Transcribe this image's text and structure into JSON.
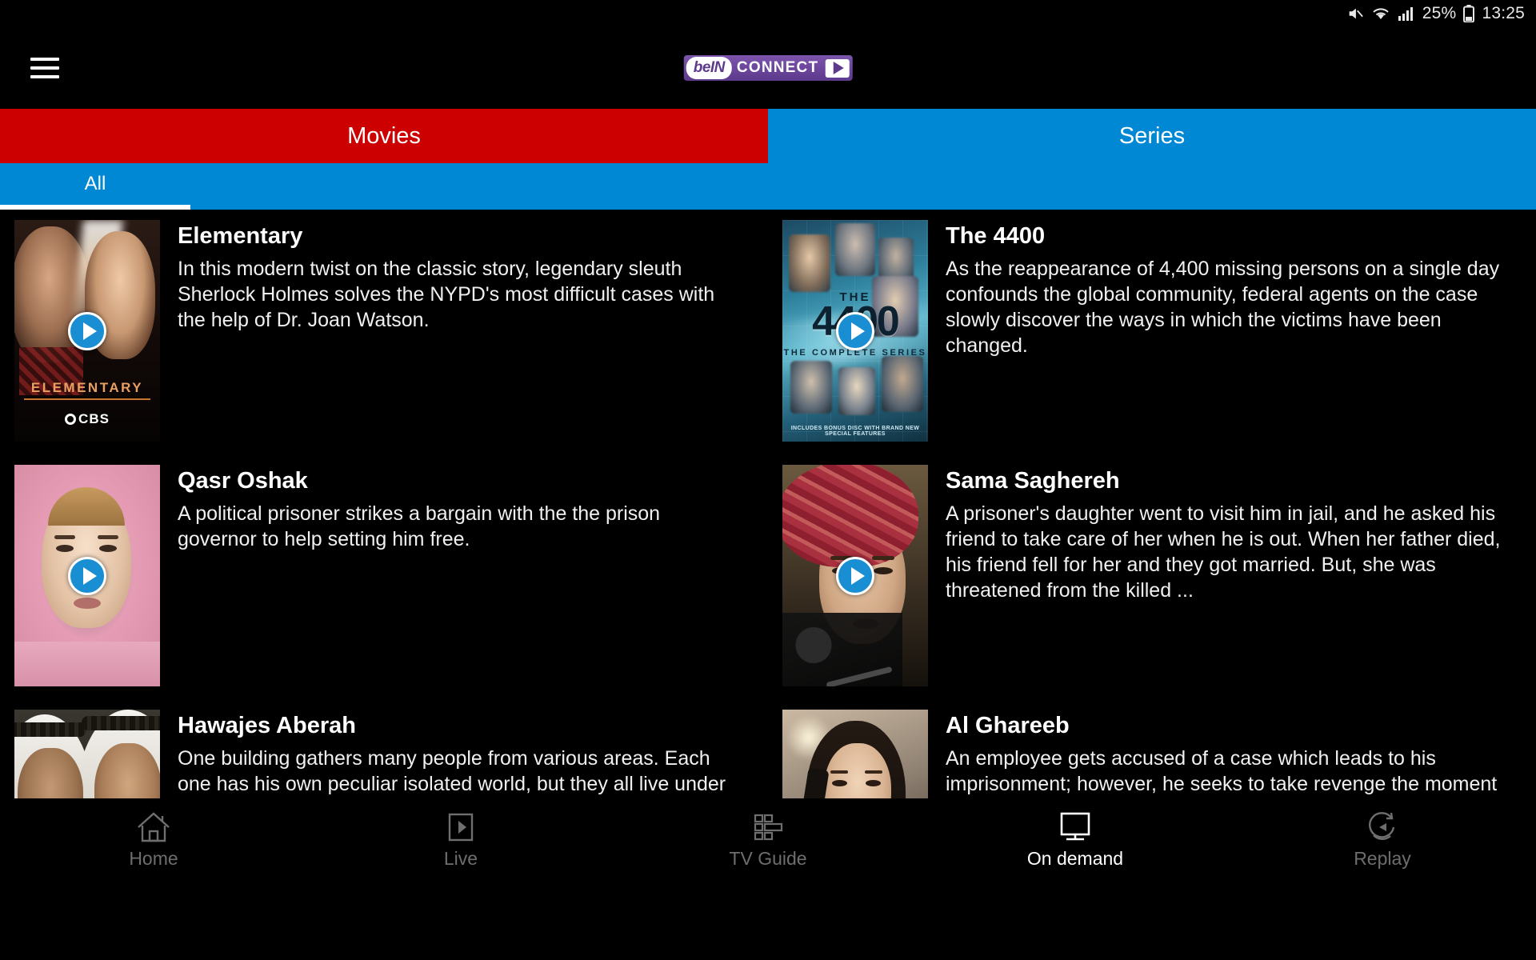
{
  "status_bar": {
    "mute_icon": "mute-icon",
    "wifi_icon": "wifi-icon",
    "signal_icon": "cellular-signal-icon",
    "battery_percent": "25%",
    "battery_icon": "battery-icon",
    "time": "13:25"
  },
  "app_bar": {
    "menu_icon": "hamburger-menu-icon",
    "logo": {
      "bein": "beIN",
      "connect": "CONNECT",
      "play_icon": "play-triangle-icon"
    }
  },
  "main_tabs": [
    {
      "label": "Movies",
      "active": false,
      "color": "#cc0000"
    },
    {
      "label": "Series",
      "active": true,
      "color": "#0088d4"
    }
  ],
  "sub_tabs": [
    {
      "label": "All",
      "active": true
    }
  ],
  "items": [
    {
      "title": "Elementary",
      "description": "In this modern twist on the classic story, legendary sleuth Sherlock Holmes solves the NYPD's most difficult cases with the help of Dr. Joan Watson.",
      "poster_text": {
        "title": "ELEMENTARY",
        "network": "CBS"
      },
      "art": "elementary"
    },
    {
      "title": "The 4400",
      "description": "As the reappearance of 4,400 missing persons on a single day confounds the global community, federal agents on the case slowly discover the ways in which the victims have been changed.",
      "poster_text": {
        "the": "THE",
        "number": "4400",
        "subtitle": "THE COMPLETE SERIES",
        "footer": "INCLUDES BONUS DISC WITH BRAND NEW SPECIAL FEATURES"
      },
      "art": "4400"
    },
    {
      "title": "Qasr Oshak",
      "description": "A political prisoner strikes a bargain with the the prison governor to help setting him free.",
      "art": "qasr"
    },
    {
      "title": "Sama Saghereh",
      "description": "A prisoner's daughter went to visit him in jail, and he asked his friend to take care of her when he is out. When her father died, his friend fell for her and they got married. But, she was threatened from the killed ...",
      "art": "sama"
    },
    {
      "title": "Hawajes Aberah",
      "description": "One building gathers many people from various areas. Each one has his own peculiar isolated world, but they all live under the same roof.",
      "art": "hawajes"
    },
    {
      "title": "Al Ghareeb",
      "description": "An employee gets accused of a case which leads to his imprisonment; however, he seeks to take revenge the moment he is set free.",
      "art": "alg"
    }
  ],
  "bottom_nav": [
    {
      "label": "Home",
      "icon": "home-icon",
      "active": false
    },
    {
      "label": "Live",
      "icon": "live-play-icon",
      "active": false
    },
    {
      "label": "TV Guide",
      "icon": "tv-guide-grid-icon",
      "active": false
    },
    {
      "label": "On demand",
      "icon": "monitor-icon",
      "active": true
    },
    {
      "label": "Replay",
      "icon": "replay-circle-play-icon",
      "active": false
    }
  ],
  "colors": {
    "movies_tab": "#cc0000",
    "series_tab": "#0088d4",
    "play_button": "#1a8ed2",
    "background": "#000000",
    "logo_purple": "#5d3a8c"
  }
}
